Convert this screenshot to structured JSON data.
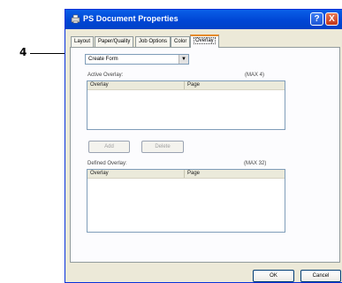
{
  "callout": {
    "number": "4"
  },
  "window": {
    "title": "PS  Document Properties",
    "help_label": "?",
    "close_label": "X"
  },
  "tabs": [
    {
      "label": "Layout"
    },
    {
      "label": "Paper/Quality"
    },
    {
      "label": "Job Options"
    },
    {
      "label": "Color"
    },
    {
      "label": "Overlay",
      "active": true
    }
  ],
  "overlay_select": {
    "value": "Create Form"
  },
  "active_overlay": {
    "label": "Active Overlay:",
    "max": "(MAX 4)",
    "columns": [
      "Overlay",
      "Page"
    ],
    "rows": []
  },
  "buttons": {
    "add": "Add",
    "delete": "Delete",
    "ok": "OK",
    "cancel": "Cancel"
  },
  "defined_overlay": {
    "label": "Defined Overlay:",
    "max": "(MAX 32)",
    "columns": [
      "Overlay",
      "Page"
    ],
    "rows": []
  },
  "colors": {
    "title_bar": "#0046d5",
    "active_tab_accent": "#e68b2c",
    "window_bg": "#ece9d8"
  }
}
